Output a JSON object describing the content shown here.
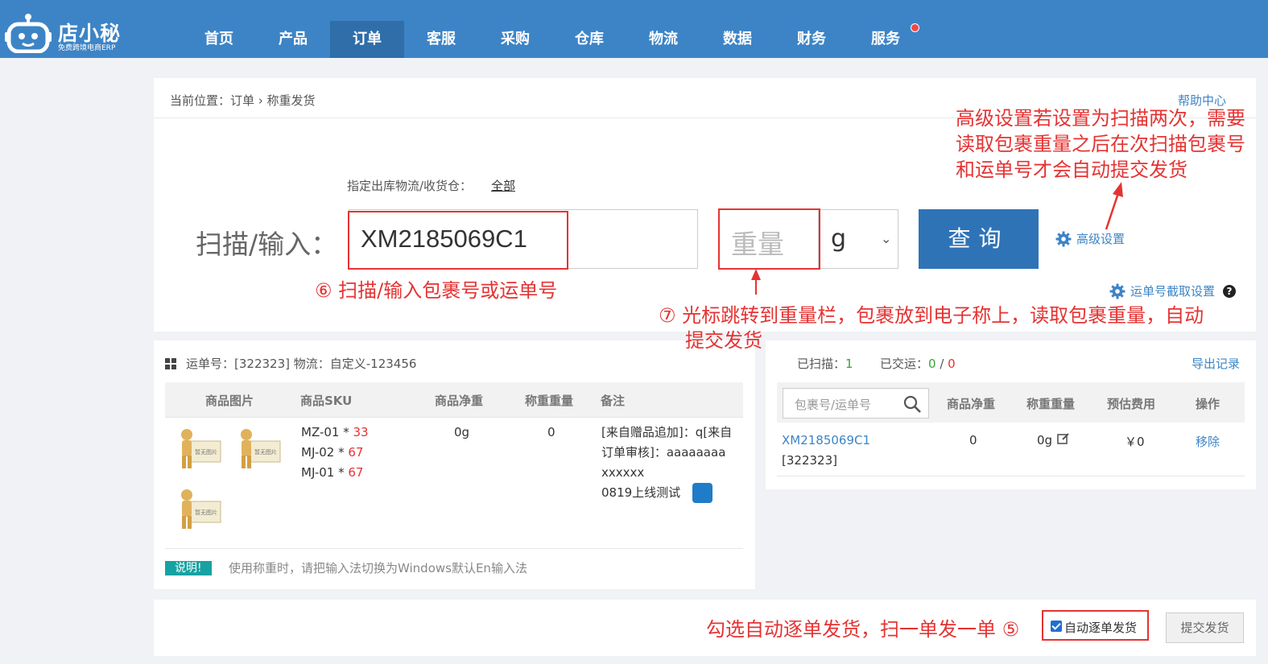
{
  "brand": {
    "name": "店小秘",
    "subtitle": "免费跨境电商ERP"
  },
  "nav": [
    {
      "label": "首页"
    },
    {
      "label": "产品"
    },
    {
      "label": "订单",
      "active": true
    },
    {
      "label": "客服"
    },
    {
      "label": "采购"
    },
    {
      "label": "仓库"
    },
    {
      "label": "物流"
    },
    {
      "label": "数据"
    },
    {
      "label": "财务"
    },
    {
      "label": "服务",
      "badge": true
    }
  ],
  "breadcrumb": {
    "text": "当前位置：订单 › 称重发货"
  },
  "help_link": "帮助中心",
  "warehouse": {
    "label": "指定出库物流/收货仓：",
    "value": "全部"
  },
  "scan": {
    "label": "扫描/输入：",
    "value": "XM2185069C1",
    "weight_placeholder": "重量",
    "unit": "g",
    "query_button": "查询",
    "advanced_settings": "高级设置",
    "cut_settings": "运单号截取设置"
  },
  "annotations": {
    "step6": "⑥   扫描/输入包裹号或运单号",
    "step7_line1": "⑦ 光标跳转到重量栏，包裹放到电子称上，读取包裹重量，自动",
    "step7_line2": "提交发货",
    "adv_line1": "高级设置若设置为扫描两次，需要",
    "adv_line2": "读取包裹重量之后在次扫描包裹号",
    "adv_line3": "和运单号才会自动提交发货",
    "step5": "勾选自动逐单发货，扫一单发一单   ⑤"
  },
  "order": {
    "header": "运单号：[322323]   物流：自定义-123456",
    "columns": [
      "商品图片",
      "商品SKU",
      "商品净重",
      "称重重量",
      "备注"
    ],
    "image_alt": "暂无图片",
    "skus": [
      {
        "code": "MZ-01 * ",
        "qty": "33"
      },
      {
        "code": "MJ-02 * ",
        "qty": "67"
      },
      {
        "code": "MJ-01 * ",
        "qty": "67"
      }
    ],
    "net_weight": "0g",
    "scale_weight": "0",
    "remarks": [
      "[来自赠品追加]：q[来自",
      "订单审核]：aaaaaaaa",
      "xxxxxx",
      "0819上线测试"
    ],
    "note_badge": "说明!",
    "note_text": "使用称重时，请把输入法切换为Windows默认En输入法"
  },
  "scanned": {
    "scanned_label": "已扫描：",
    "scanned_count": "1",
    "shipped_label": "已交运：",
    "shipped_count": "0",
    "shipped_sep": " / ",
    "shipped_total": "0",
    "export": "导出记录",
    "search_placeholder": "包裹号/运单号",
    "columns": [
      "商品净重",
      "称重重量",
      "预估费用",
      "操作"
    ],
    "row": {
      "package_no": "XM2185069C1",
      "tracking": "[322323]",
      "net_weight": "0",
      "scale_weight": "0g",
      "fee": "￥0",
      "action": "移除"
    }
  },
  "bottom": {
    "auto_ship_label": "自动逐单发货",
    "auto_ship_checked": true,
    "submit_button": "提交发货"
  },
  "colors": {
    "nav_bg": "#3d84c6",
    "nav_active": "#2f6ea9",
    "primary_button": "#2f73b7",
    "annotation": "#e53333",
    "link": "#3d84c6"
  }
}
